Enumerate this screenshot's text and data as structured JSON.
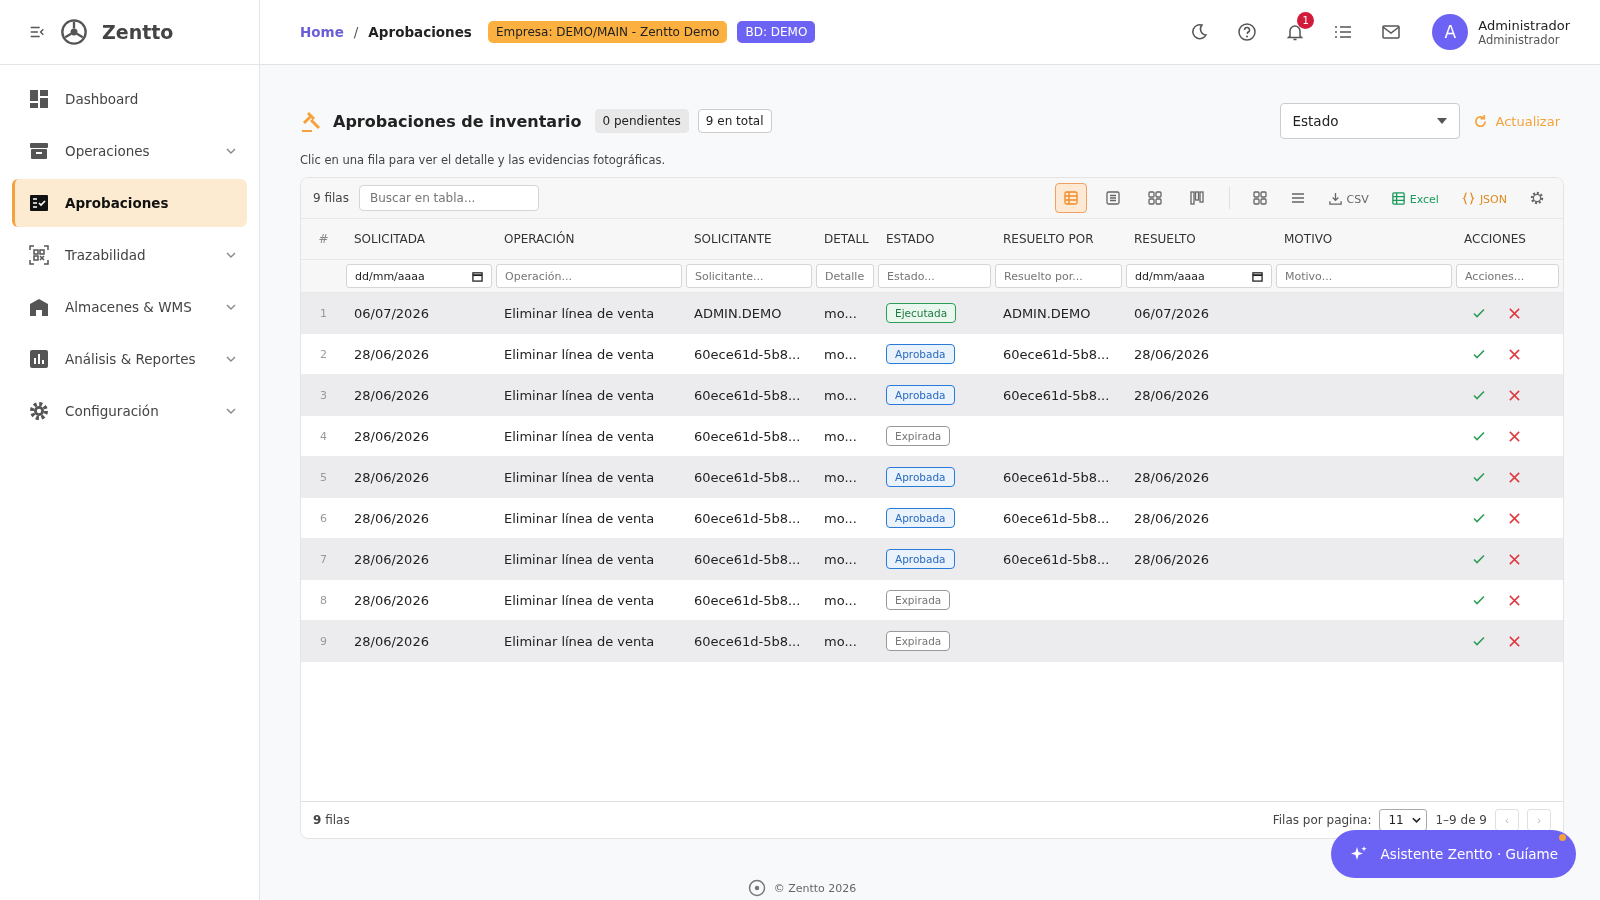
{
  "app": {
    "name": "Zentto"
  },
  "sidebar": {
    "items": [
      {
        "label": "Dashboard",
        "kind": "link",
        "selected": false
      },
      {
        "label": "Operaciones",
        "kind": "group",
        "selected": false
      },
      {
        "label": "Aprobaciones",
        "kind": "link",
        "selected": true
      },
      {
        "label": "Trazabilidad",
        "kind": "group",
        "selected": false
      },
      {
        "label": "Almacenes & WMS",
        "kind": "group",
        "selected": false
      },
      {
        "label": "Análisis & Reportes",
        "kind": "group",
        "selected": false
      },
      {
        "label": "Configuración",
        "kind": "group",
        "selected": false
      }
    ]
  },
  "breadcrumb": [
    "Home",
    "/",
    "Aprobaciones"
  ],
  "badges": [
    {
      "label": "Empresa: DEMO/MAIN - Zentto Demo",
      "color": "#fbb040"
    },
    {
      "label": "BD: DEMO",
      "color": "#6c63f5"
    }
  ],
  "header": {
    "notifications": "1",
    "avatar": "A",
    "user_name": "Administrador",
    "user_role": "Administrador"
  },
  "page": {
    "title": "Aprobaciones de inventario",
    "pending": "0 pendientes",
    "total": "9 en total",
    "hint": "Clic en una fila para ver el detalle y las evidencias fotográficas.",
    "status_select": "Estado",
    "refresh": "Actualizar"
  },
  "toolbar": {
    "count": "9 filas",
    "search_placeholder": "Buscar en tabla...",
    "views": [
      {
        "selected": true
      },
      {
        "selected": false
      },
      {
        "selected": false
      },
      {
        "selected": false
      }
    ],
    "exports": [
      {
        "label": "CSV",
        "kind": "csv"
      },
      {
        "label": "Excel",
        "kind": "excel"
      },
      {
        "label": "JSON",
        "kind": "json"
      }
    ]
  },
  "table": {
    "columns": [
      "#",
      "SOLICITADA",
      "OPERACIÓN",
      "SOLICITANTE",
      "DETALL",
      "ESTADO",
      "RESUELTO POR",
      "RESUELTO",
      "MOTIVO",
      "ACCIONES"
    ],
    "filters": [
      {
        "kind": "date",
        "value": "dd/mm/aaaa"
      },
      {
        "kind": "text",
        "placeholder": "Operación..."
      },
      {
        "kind": "text",
        "placeholder": "Solicitante..."
      },
      {
        "kind": "text",
        "placeholder": "Detalle"
      },
      {
        "kind": "text",
        "placeholder": "Estado..."
      },
      {
        "kind": "text",
        "placeholder": "Resuelto por..."
      },
      {
        "kind": "date",
        "value": "dd/mm/aaaa"
      },
      {
        "kind": "text",
        "placeholder": "Motivo..."
      },
      {
        "kind": "text",
        "placeholder": "Acciones..."
      }
    ],
    "rows": [
      {
        "n": "1",
        "requested": "06/07/2026",
        "operation": "Eliminar línea de venta",
        "requester": "ADMIN.DEMO",
        "detail": "mo...",
        "status": "Ejecutada",
        "kind": "executed",
        "resolved_by": "ADMIN.DEMO",
        "resolved": "06/07/2026"
      },
      {
        "n": "2",
        "requested": "28/06/2026",
        "operation": "Eliminar línea de venta",
        "requester": "60ece61d-5b8...",
        "detail": "mo...",
        "status": "Aprobada",
        "kind": "approved",
        "resolved_by": "60ece61d-5b8...",
        "resolved": "28/06/2026"
      },
      {
        "n": "3",
        "requested": "28/06/2026",
        "operation": "Eliminar línea de venta",
        "requester": "60ece61d-5b8...",
        "detail": "mo...",
        "status": "Aprobada",
        "kind": "approved",
        "resolved_by": "60ece61d-5b8...",
        "resolved": "28/06/2026"
      },
      {
        "n": "4",
        "requested": "28/06/2026",
        "operation": "Eliminar línea de venta",
        "requester": "60ece61d-5b8...",
        "detail": "mo...",
        "status": "Expirada",
        "kind": "expired"
      },
      {
        "n": "5",
        "requested": "28/06/2026",
        "operation": "Eliminar línea de venta",
        "requester": "60ece61d-5b8...",
        "detail": "mo...",
        "status": "Aprobada",
        "kind": "approved",
        "resolved_by": "60ece61d-5b8...",
        "resolved": "28/06/2026"
      },
      {
        "n": "6",
        "requested": "28/06/2026",
        "operation": "Eliminar línea de venta",
        "requester": "60ece61d-5b8...",
        "detail": "mo...",
        "status": "Aprobada",
        "kind": "approved",
        "resolved_by": "60ece61d-5b8...",
        "resolved": "28/06/2026"
      },
      {
        "n": "7",
        "requested": "28/06/2026",
        "operation": "Eliminar línea de venta",
        "requester": "60ece61d-5b8...",
        "detail": "mo...",
        "status": "Aprobada",
        "kind": "approved",
        "resolved_by": "60ece61d-5b8...",
        "resolved": "28/06/2026"
      },
      {
        "n": "8",
        "requested": "28/06/2026",
        "operation": "Eliminar línea de venta",
        "requester": "60ece61d-5b8...",
        "detail": "mo...",
        "status": "Expirada",
        "kind": "expired"
      },
      {
        "n": "9",
        "requested": "28/06/2026",
        "operation": "Eliminar línea de venta",
        "requester": "60ece61d-5b8...",
        "detail": "mo...",
        "status": "Expirada",
        "kind": "expired"
      }
    ]
  },
  "footer": {
    "count": "**9** filas",
    "per_page_label": "Filas por pagina:",
    "per_page": "11",
    "range": "1–9 de 9",
    "prev": "‹",
    "next": "›"
  },
  "assistant": "Asistente Zentto · Guíame",
  "copyright": "© Zentto 2026"
}
